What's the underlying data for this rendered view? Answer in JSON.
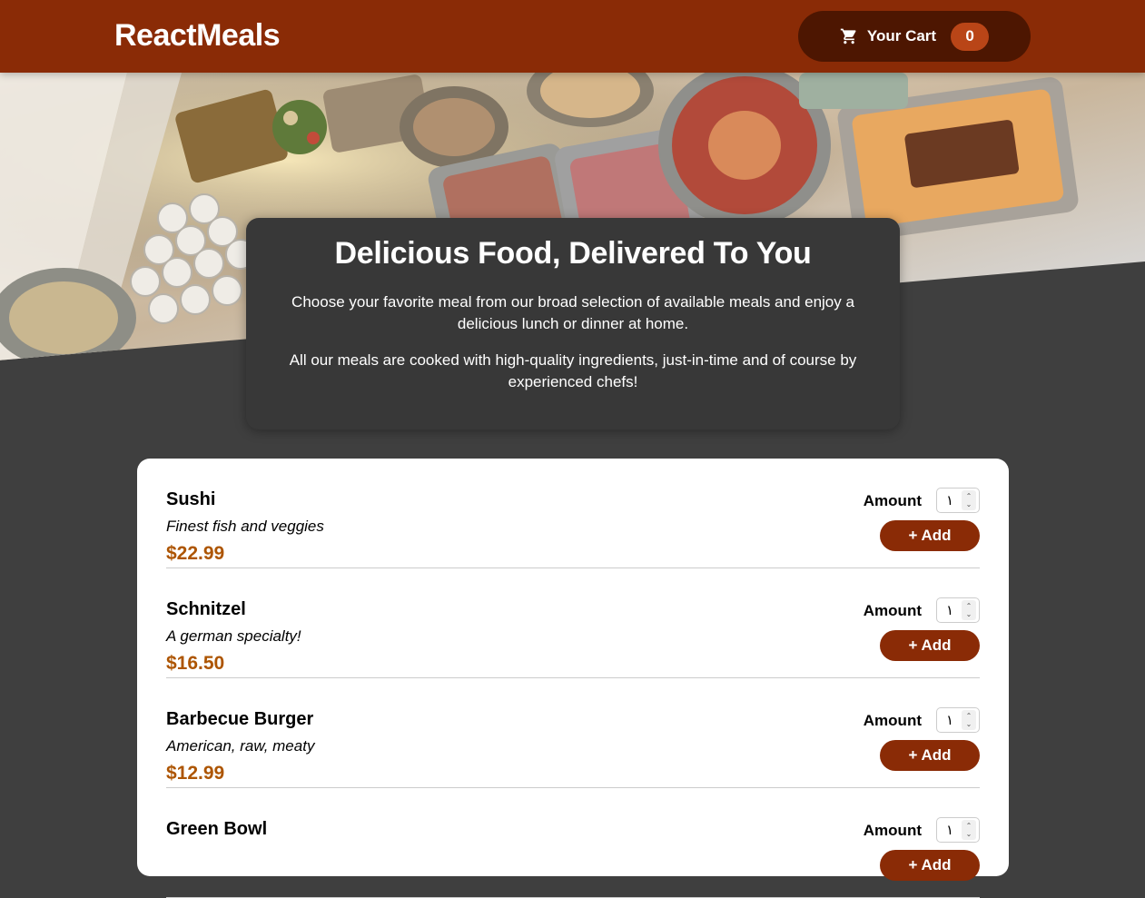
{
  "header": {
    "brand": "ReactMeals",
    "cart_label": "Your Cart",
    "cart_count": "0",
    "cart_icon": "cart-icon"
  },
  "summary": {
    "title": "Delicious Food, Delivered To You",
    "paragraph_1": "Choose your favorite meal from our broad selection of available meals and enjoy a delicious lunch or dinner at home.",
    "paragraph_2": "All our meals are cooked with high-quality ingredients, just-in-time and of course by experienced chefs!"
  },
  "meals": [
    {
      "name": "Sushi",
      "description": "Finest fish and veggies",
      "price": "$22.99",
      "amount_label": "Amount",
      "amount_value": "١",
      "add_label": "+ Add"
    },
    {
      "name": "Schnitzel",
      "description": "A german specialty!",
      "price": "$16.50",
      "amount_label": "Amount",
      "amount_value": "١",
      "add_label": "+ Add"
    },
    {
      "name": "Barbecue Burger",
      "description": "American, raw, meaty",
      "price": "$12.99",
      "amount_label": "Amount",
      "amount_value": "١",
      "add_label": "+ Add"
    },
    {
      "name": "Green Bowl",
      "description": "",
      "price": "",
      "amount_label": "Amount",
      "amount_value": "١",
      "add_label": "+ Add"
    }
  ],
  "colors": {
    "header_bg": "#8a2b06",
    "cart_button_bg": "#4d1601",
    "badge_bg": "#b94517",
    "page_bg": "#3f3f3f",
    "summary_bg": "#383838",
    "price": "#ad5502"
  }
}
